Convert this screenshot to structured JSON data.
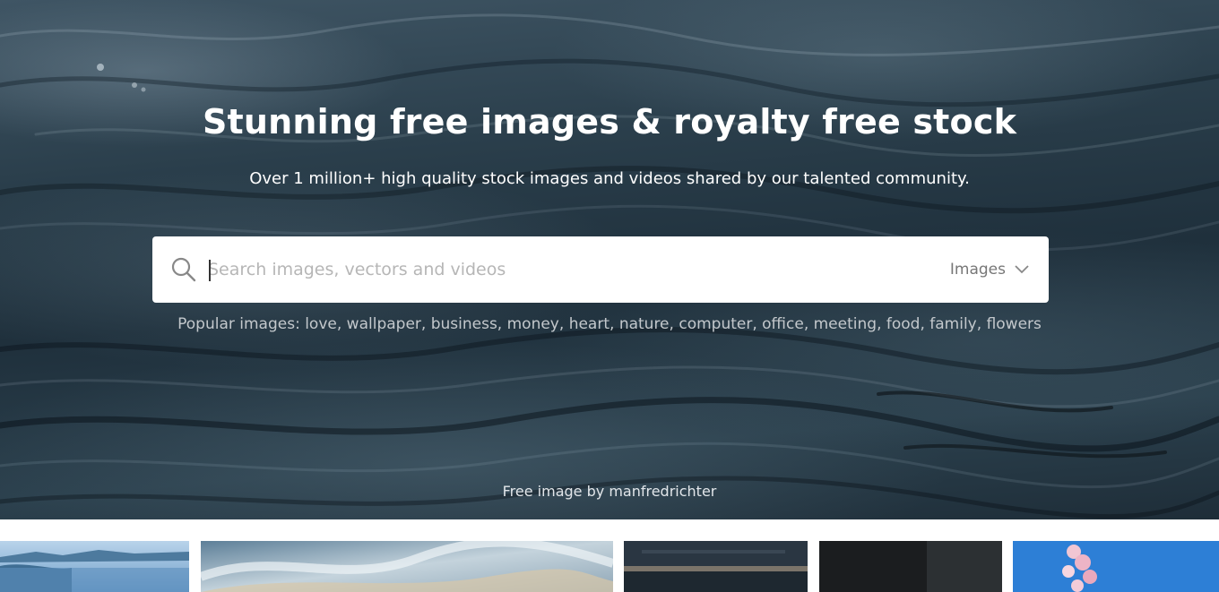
{
  "hero": {
    "title": "Stunning free images & royalty free stock",
    "subtitle": "Over 1 million+ high quality stock images and videos shared by our talented community."
  },
  "search": {
    "placeholder": "Search images, vectors and videos",
    "value": "",
    "type_selected": "Images",
    "icon": "search-icon",
    "dropdown_icon": "chevron-down-icon"
  },
  "popular": {
    "prefix": "Popular images:",
    "tags": [
      "love",
      "wallpaper",
      "business",
      "money",
      "heart",
      "nature",
      "computer",
      "office",
      "meeting",
      "food",
      "family",
      "flowers"
    ]
  },
  "credit": {
    "prefix": "Free image by",
    "author": "manfredrichter"
  },
  "colors": {
    "hero_dark": "#1f303c",
    "search_bg": "#ffffff",
    "placeholder": "#b6b6b6",
    "popular_text": "#c3c8cc"
  },
  "thumbnails": [
    {
      "name": "coastal-bay"
    },
    {
      "name": "cloudy-sky"
    },
    {
      "name": "dark-building"
    },
    {
      "name": "dark-portrait"
    },
    {
      "name": "cherry-blossom"
    }
  ]
}
